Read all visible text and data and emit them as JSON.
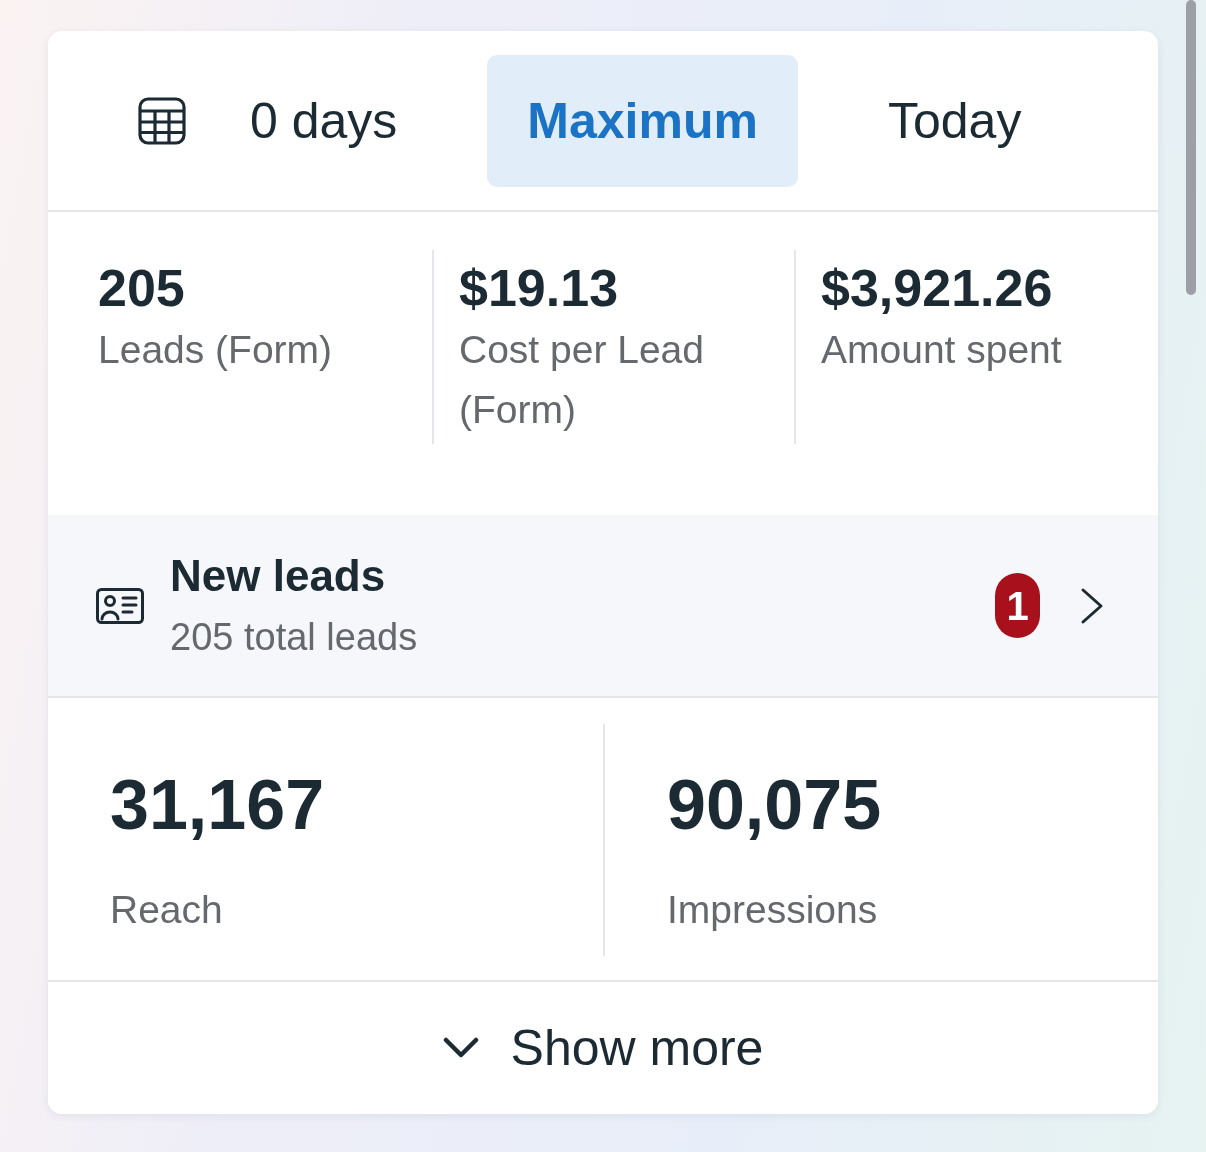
{
  "date_range": {
    "tabs": [
      {
        "kind": "custom_range",
        "label": "0 days",
        "selected": false
      },
      {
        "kind": "preset",
        "label": "Maximum",
        "selected": true
      },
      {
        "kind": "preset",
        "label": "Today",
        "selected": false
      }
    ]
  },
  "summary_metrics": [
    {
      "value": "205",
      "label": "Leads (Form)"
    },
    {
      "value": "$19.13",
      "label": "Cost per Lead (Form)"
    },
    {
      "value": "$3,921.26",
      "label": "Amount spent"
    }
  ],
  "new_leads": {
    "title": "New leads",
    "subtitle": "205 total leads",
    "badge": "1"
  },
  "reach_metrics": [
    {
      "value": "31,167",
      "label": "Reach"
    },
    {
      "value": "90,075",
      "label": "Impressions"
    }
  ],
  "show_more": {
    "label": "Show more"
  }
}
